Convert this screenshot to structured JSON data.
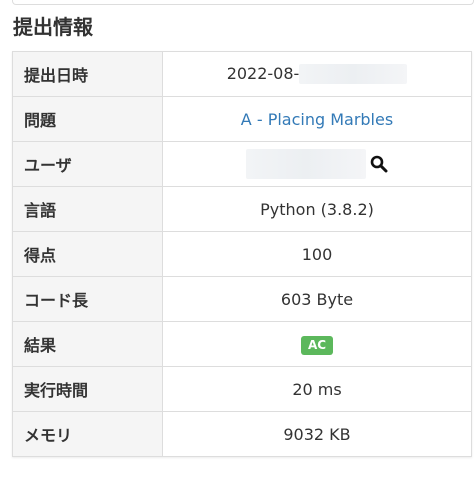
{
  "section_title": "提出情報",
  "rows": {
    "submit_time": {
      "label": "提出日時",
      "value": "2022-08-"
    },
    "problem": {
      "label": "問題",
      "value": "A - Placing Marbles"
    },
    "user": {
      "label": "ユーザ"
    },
    "language": {
      "label": "言語",
      "value": "Python (3.8.2)"
    },
    "score": {
      "label": "得点",
      "value": "100"
    },
    "code_length": {
      "label": "コード長",
      "value": "603 Byte"
    },
    "result": {
      "label": "結果",
      "value": "AC",
      "color": "#5cb85c"
    },
    "exec_time": {
      "label": "実行時間",
      "value": "20 ms"
    },
    "memory": {
      "label": "メモリ",
      "value": "9032 KB"
    }
  },
  "icons": {
    "user_search": "search-icon"
  },
  "colors": {
    "link": "#337ab7",
    "header_bg": "#f5f5f5",
    "border": "#dddddd"
  }
}
